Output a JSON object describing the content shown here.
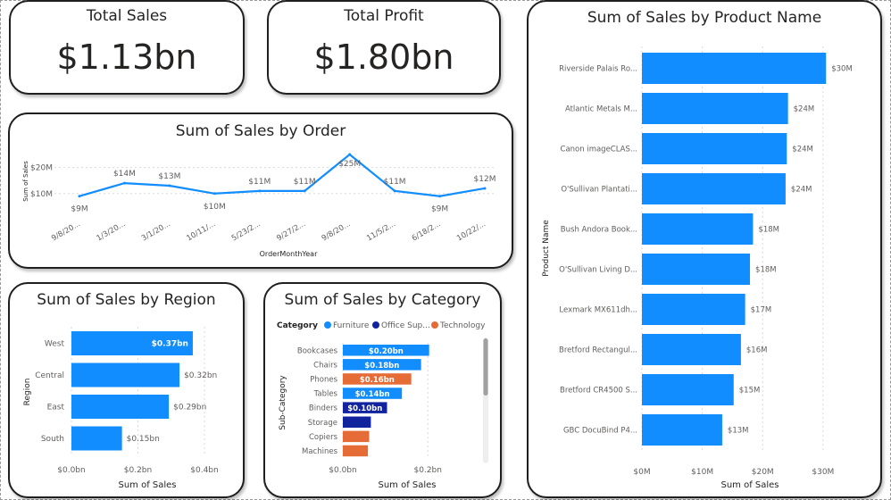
{
  "kpis": {
    "total_sales": {
      "title": "Total Sales",
      "value": "$1.13bn"
    },
    "total_profit": {
      "title": "Total Profit",
      "value": "$1.80bn"
    }
  },
  "colors": {
    "primary": "#118DFF",
    "office_supplies": "#12239E",
    "technology": "#E66C37",
    "axis_text": "#605E5C",
    "border": "#1f1f1f"
  },
  "chart_data": [
    {
      "id": "sales_by_order",
      "type": "line",
      "title": "Sum of Sales by Order",
      "xlabel": "OrderMonthYear",
      "ylabel": "Sum of Sales",
      "x": [
        "9/8/20...",
        "1/3/20...",
        "3/1/20...",
        "10/11/...",
        "5/23/2...",
        "9/27/2...",
        "9/8/20...",
        "11/5/2...",
        "6/18/2...",
        "10/22/..."
      ],
      "values": [
        9,
        14,
        13,
        10,
        11,
        11,
        25,
        11,
        9,
        12
      ],
      "data_labels": [
        "$9M",
        "$14M",
        "$13M",
        "$10M",
        "$11M",
        "$11M",
        "$25M",
        "$11M",
        "$9M",
        "$12M"
      ],
      "yticks": [
        "$10M",
        "$20M"
      ],
      "ytick_values": [
        10,
        20
      ],
      "ylim": [
        6.5,
        25
      ]
    },
    {
      "id": "sales_by_product",
      "type": "bar",
      "orientation": "horizontal",
      "title": "Sum of Sales by Product Name",
      "xlabel": "Sum of Sales",
      "ylabel": "Product Name",
      "categories": [
        "Riverside Palais Ro...",
        "Atlantic Metals M...",
        "Canon imageCLAS...",
        "O'Sullivan Plantati...",
        "Bush Andora Book...",
        "O'Sullivan Living D...",
        "Lexmark MX611dh...",
        "Bretford Rectangul...",
        "Bretford CR4500 S...",
        "GBC DocuBind P4..."
      ],
      "values": [
        30.5,
        24.2,
        24.0,
        23.8,
        18.4,
        17.9,
        17.1,
        16.4,
        15.2,
        13.3
      ],
      "data_labels": [
        "$30M",
        "$24M",
        "$24M",
        "$24M",
        "$18M",
        "$18M",
        "$17M",
        "$16M",
        "$15M",
        "$13M"
      ],
      "xticks": [
        "$0M",
        "$10M",
        "$20M",
        "$30M"
      ],
      "xtick_values": [
        0,
        10,
        20,
        30
      ],
      "xlim": [
        0,
        31.5
      ]
    },
    {
      "id": "sales_by_region",
      "type": "bar",
      "orientation": "horizontal",
      "title": "Sum of Sales by Region",
      "xlabel": "Sum of Sales",
      "ylabel": "Region",
      "categories": [
        "West",
        "Central",
        "East",
        "South"
      ],
      "values": [
        0.365,
        0.325,
        0.293,
        0.152
      ],
      "data_labels": [
        "$0.37bn",
        "$0.32bn",
        "$0.29bn",
        "$0.15bn"
      ],
      "xticks": [
        "$0.0bn",
        "$0.2bn",
        "$0.4bn"
      ],
      "xtick_values": [
        0,
        0.2,
        0.4
      ],
      "xlim": [
        0,
        0.4
      ]
    },
    {
      "id": "sales_by_category",
      "type": "bar",
      "orientation": "horizontal",
      "title": "Sum of Sales by Category",
      "xlabel": "Sum of Sales",
      "ylabel": "Sub-Category",
      "legend": {
        "title": "Category",
        "items": [
          {
            "name": "Furniture",
            "color": "#118DFF"
          },
          {
            "name": "Office Sup...",
            "color": "#12239E"
          },
          {
            "name": "Technology",
            "color": "#E66C37"
          }
        ]
      },
      "categories": [
        "Bookcases",
        "Chairs",
        "Phones",
        "Tables",
        "Binders",
        "Storage",
        "Copiers",
        "Machines"
      ],
      "category_group": [
        "Furniture",
        "Furniture",
        "Technology",
        "Furniture",
        "Office Sup...",
        "Office Sup...",
        "Technology",
        "Technology"
      ],
      "values": [
        0.203,
        0.184,
        0.161,
        0.139,
        0.104,
        0.066,
        0.062,
        0.059
      ],
      "data_labels": [
        "$0.20bn",
        "$0.18bn",
        "$0.16bn",
        "$0.14bn",
        "$0.10bn",
        "",
        "",
        ""
      ],
      "xticks": [
        "$0.0bn",
        "$0.2bn"
      ],
      "xtick_values": [
        0,
        0.2
      ],
      "xlim": [
        0,
        0.315
      ]
    }
  ]
}
